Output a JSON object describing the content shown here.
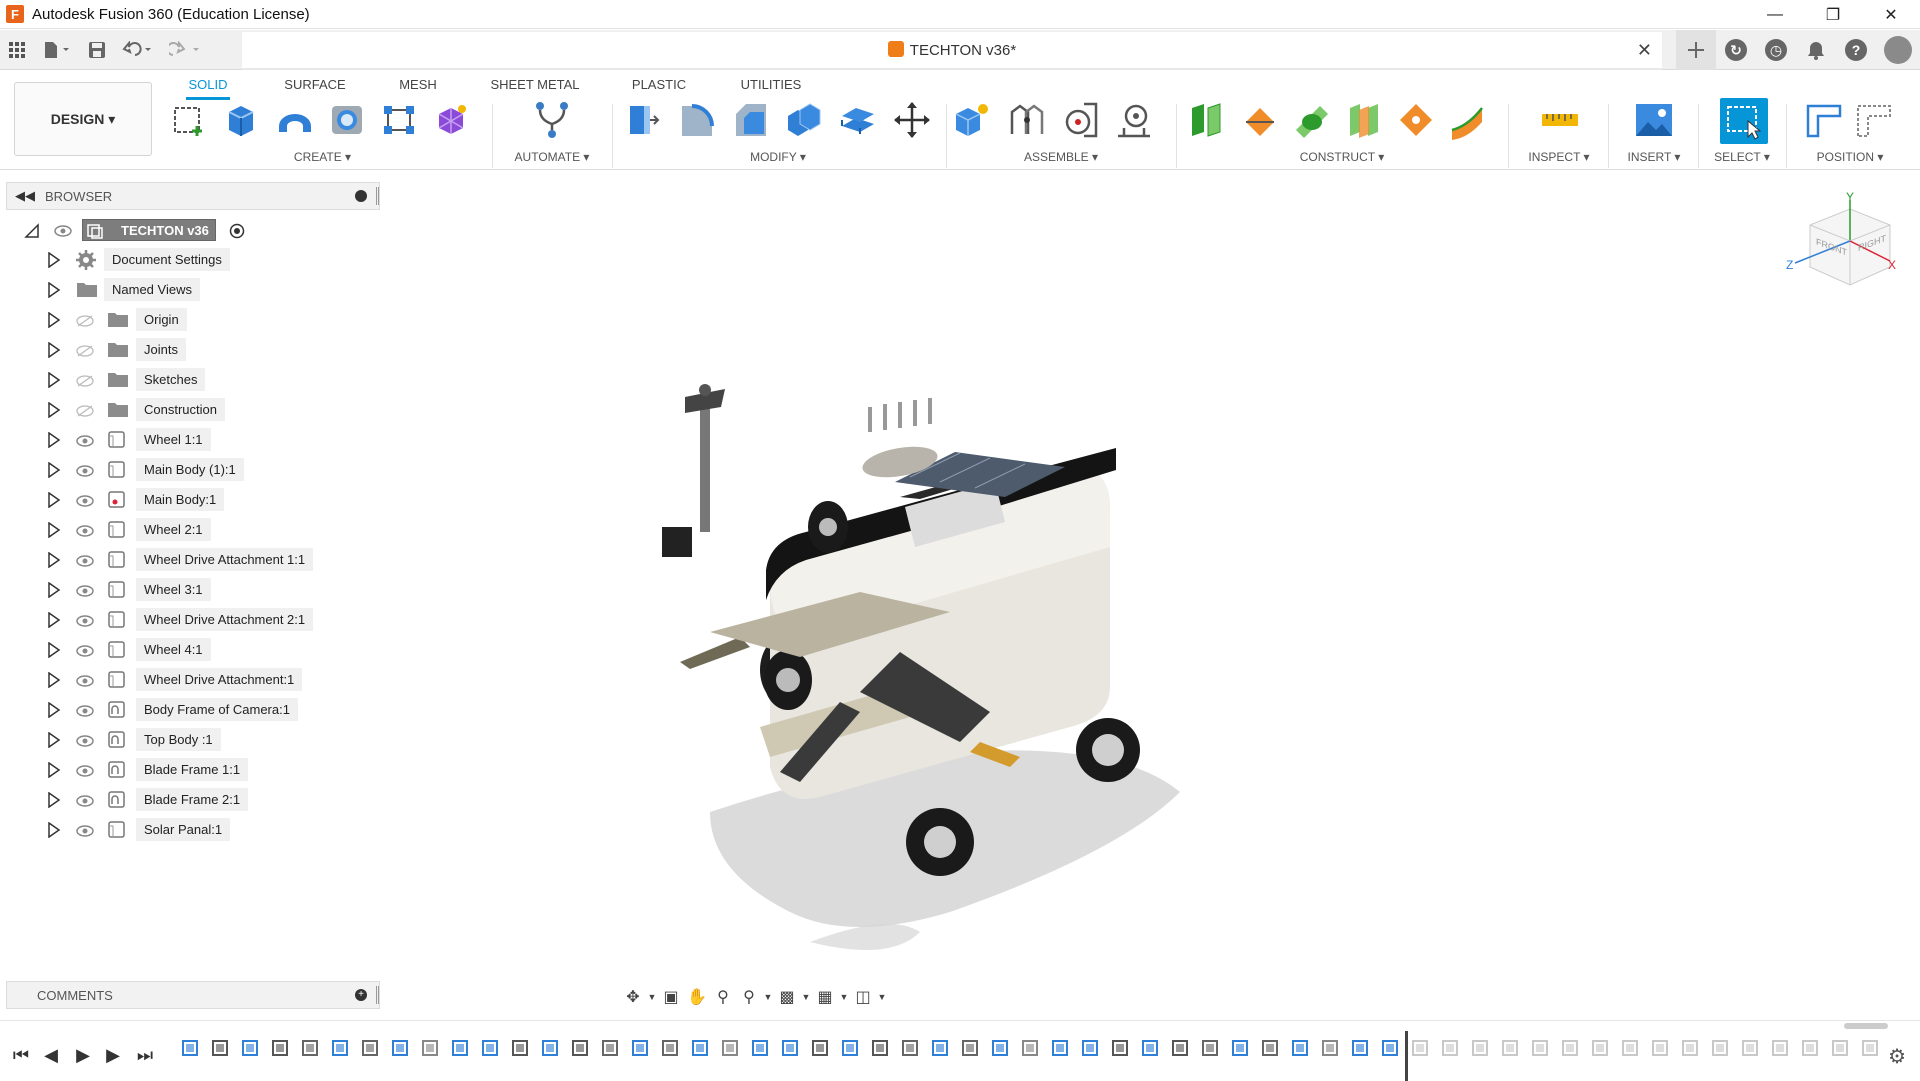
{
  "window": {
    "title": "Autodesk Fusion 360 (Education License)"
  },
  "document": {
    "tab_title": "TECHTON v36*"
  },
  "ribbon": {
    "workspace_button": "DESIGN ▾",
    "tabs": [
      "SOLID",
      "SURFACE",
      "MESH",
      "SHEET METAL",
      "PLASTIC",
      "UTILITIES"
    ],
    "active_tab": "SOLID",
    "groups": {
      "create": "CREATE ▾",
      "automate": "AUTOMATE ▾",
      "modify": "MODIFY ▾",
      "assemble": "ASSEMBLE ▾",
      "construct": "CONSTRUCT ▾",
      "inspect": "INSPECT ▾",
      "insert": "INSERT ▾",
      "select": "SELECT ▾",
      "position": "POSITION ▾"
    }
  },
  "browser": {
    "header": "BROWSER",
    "root": "TECHTON v36",
    "items": [
      {
        "label": "Document Settings",
        "icon": "gear-icon",
        "eye": "none"
      },
      {
        "label": "Named Views",
        "icon": "folder-icon",
        "eye": "none"
      },
      {
        "label": "Origin",
        "icon": "folder-icon",
        "eye": "hidden"
      },
      {
        "label": "Joints",
        "icon": "folder-icon",
        "eye": "hidden"
      },
      {
        "label": "Sketches",
        "icon": "folder-icon",
        "eye": "hidden"
      },
      {
        "label": "Construction",
        "icon": "folder-icon",
        "eye": "hidden"
      },
      {
        "label": "Wheel 1:1",
        "icon": "component-icon",
        "eye": "visible"
      },
      {
        "label": "Main Body (1):1",
        "icon": "component-icon",
        "eye": "visible"
      },
      {
        "label": "Main Body:1",
        "icon": "component-warning-icon",
        "eye": "visible"
      },
      {
        "label": "Wheel 2:1",
        "icon": "component-icon",
        "eye": "visible"
      },
      {
        "label": "Wheel Drive Attachment 1:1",
        "icon": "component-icon",
        "eye": "visible"
      },
      {
        "label": "Wheel 3:1",
        "icon": "component-icon",
        "eye": "visible"
      },
      {
        "label": "Wheel Drive Attachment 2:1",
        "icon": "component-icon",
        "eye": "visible"
      },
      {
        "label": "Wheel 4:1",
        "icon": "component-icon",
        "eye": "visible"
      },
      {
        "label": "Wheel Drive Attachment:1",
        "icon": "component-icon",
        "eye": "visible"
      },
      {
        "label": "Body Frame of Camera:1",
        "icon": "component-linked-icon",
        "eye": "visible"
      },
      {
        "label": "Top Body :1",
        "icon": "component-linked-icon",
        "eye": "visible"
      },
      {
        "label": "Blade Frame 1:1",
        "icon": "component-linked-icon",
        "eye": "visible"
      },
      {
        "label": "Blade Frame 2:1",
        "icon": "component-linked-icon",
        "eye": "visible"
      },
      {
        "label": "Solar Panal:1",
        "icon": "component-icon",
        "eye": "visible"
      }
    ]
  },
  "viewcube": {
    "front": "FRONT",
    "right": "RIGHT",
    "axis_x": "X",
    "axis_y": "Y",
    "axis_z": "Z"
  },
  "comments": {
    "header": "COMMENTS"
  }
}
